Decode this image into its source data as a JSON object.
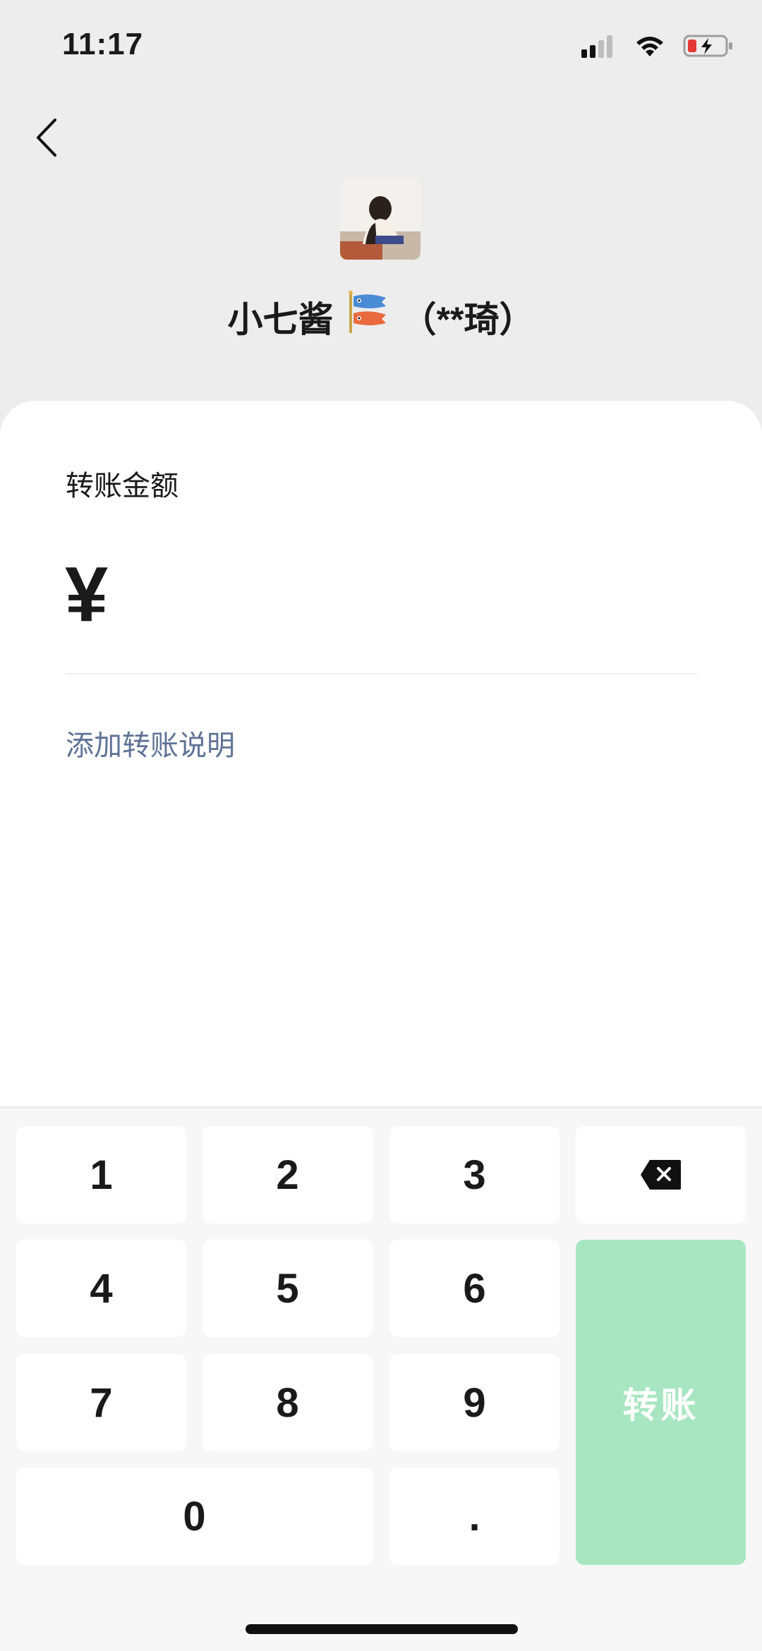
{
  "status_bar": {
    "time": "11:17"
  },
  "recipient": {
    "name": "小七酱",
    "masked_name": "（**琦）",
    "flag_icon": "carp-streamer-icon"
  },
  "card": {
    "amount_label": "转账金额",
    "currency_symbol": "¥",
    "add_note": "添加转账说明"
  },
  "keypad": {
    "keys": {
      "k1": "1",
      "k2": "2",
      "k3": "3",
      "k4": "4",
      "k5": "5",
      "k6": "6",
      "k7": "7",
      "k8": "8",
      "k9": "9",
      "k0": "0",
      "dot": "."
    },
    "delete_icon": "backspace-icon",
    "transfer_label": "转账"
  },
  "colors": {
    "transfer_button": "#A8E6C1",
    "link": "#5F7396",
    "battery_low": "#E53935"
  }
}
